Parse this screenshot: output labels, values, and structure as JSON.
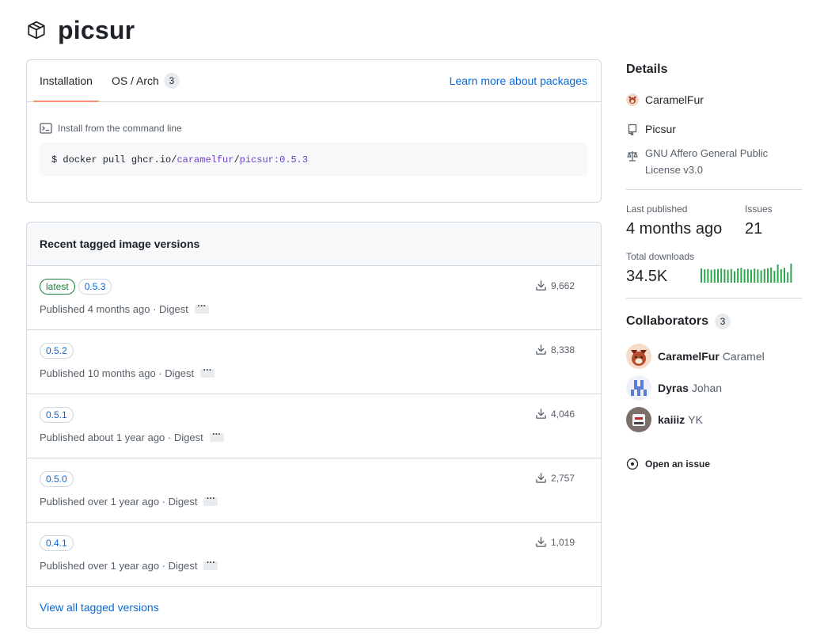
{
  "package": {
    "name": "picsur"
  },
  "install": {
    "tabs": [
      {
        "label": "Installation"
      },
      {
        "label": "OS / Arch",
        "count": "3"
      }
    ],
    "learn_link": "Learn more about packages",
    "command_label": "Install from the command line",
    "command": {
      "prefix": "$ docker pull ghcr.io/",
      "owner": "caramelfur",
      "sep": "/",
      "image": "picsur",
      "tag": ":0.5.3"
    }
  },
  "versions": {
    "title": "Recent tagged image versions",
    "digest_label": "Digest",
    "ellipsis": "···",
    "rows": [
      {
        "tags": [
          "latest",
          "0.5.3"
        ],
        "published": "Published 4 months ago · ",
        "downloads": "9,662"
      },
      {
        "tags": [
          "0.5.2"
        ],
        "published": "Published 10 months ago · ",
        "downloads": "8,338"
      },
      {
        "tags": [
          "0.5.1"
        ],
        "published": "Published about 1 year ago · ",
        "downloads": "4,046"
      },
      {
        "tags": [
          "0.5.0"
        ],
        "published": "Published over 1 year ago · ",
        "downloads": "2,757"
      },
      {
        "tags": [
          "0.4.1"
        ],
        "published": "Published over 1 year ago · ",
        "downloads": "1,019"
      }
    ],
    "view_all": "View all tagged versions"
  },
  "sidebar": {
    "details_title": "Details",
    "owner": "CaramelFur",
    "repo": "Picsur",
    "license": "GNU Affero General Public License v3.0",
    "last_published_label": "Last published",
    "last_published_value": "4 months ago",
    "issues_label": "Issues",
    "issues_value": "21",
    "downloads_label": "Total downloads",
    "downloads_value": "34.5K",
    "sparkline": [
      0.75,
      0.7,
      0.72,
      0.68,
      0.7,
      0.72,
      0.74,
      0.7,
      0.68,
      0.72,
      0.6,
      0.75,
      0.78,
      0.7,
      0.72,
      0.68,
      0.74,
      0.7,
      0.65,
      0.72,
      0.76,
      0.8,
      0.62,
      0.95,
      0.7,
      0.78,
      0.55,
      1.0
    ],
    "accent_color": "#2da44e",
    "collaborators_title": "Collaborators",
    "collaborators_count": "3",
    "collaborators": [
      {
        "login": "CaramelFur",
        "name": "Caramel",
        "avatar": "fox-avatar"
      },
      {
        "login": "Dyras",
        "name": "Johan",
        "avatar": "pixel-avatar"
      },
      {
        "login": "kaiiiz",
        "name": "YK",
        "avatar": "robot-avatar"
      }
    ],
    "open_issue": "Open an issue"
  }
}
